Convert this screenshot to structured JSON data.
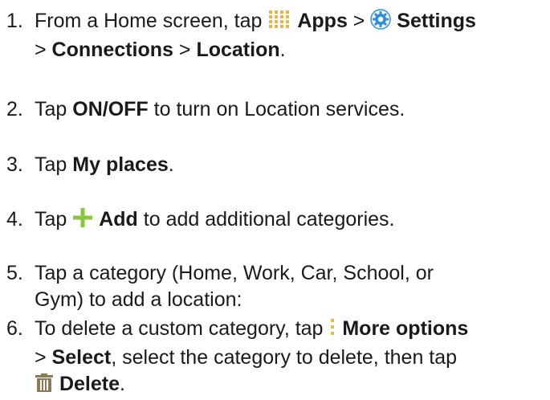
{
  "steps": [
    {
      "number": "1.",
      "t1": "From a Home screen, tap ",
      "apps": "Apps",
      "sep1": " > ",
      "settings": "Settings",
      "sep2": "> ",
      "connections": "Connections",
      "sep3": " > ",
      "location": "Location",
      "end": ".",
      "icons": [
        "apps-grid-icon",
        "settings-gear-icon"
      ]
    },
    {
      "number": "2.",
      "t1": "Tap ",
      "onoff": "ON/OFF",
      "t2": " to turn on Location services."
    },
    {
      "number": "3.",
      "t1": "Tap ",
      "myplaces": "My places",
      "end": "."
    },
    {
      "number": "4.",
      "t1": "Tap ",
      "add": "Add",
      "t2": " to add additional categories.",
      "icons": [
        "add-plus-icon"
      ]
    },
    {
      "number": "5.",
      "line1": "Tap a category (Home, Work, Car, School, or",
      "line2": "Gym) to add a location:"
    },
    {
      "number": "6.",
      "t1": "To delete a custom category, tap ",
      "more": "More options",
      "sep1": "> ",
      "select": "Select",
      "t2": ", select the category to delete, then tap",
      "delete": "Delete",
      "end": ".",
      "icons": [
        "more-options-icon",
        "delete-trash-icon"
      ]
    }
  ],
  "colors": {
    "text": "#1a1a1a",
    "icon_apps": "#e6b84a",
    "icon_settings": "#2f8fd8",
    "icon_add": "#8cc63e",
    "icon_more": "#e6b84a",
    "icon_delete": "#8a7a55"
  }
}
